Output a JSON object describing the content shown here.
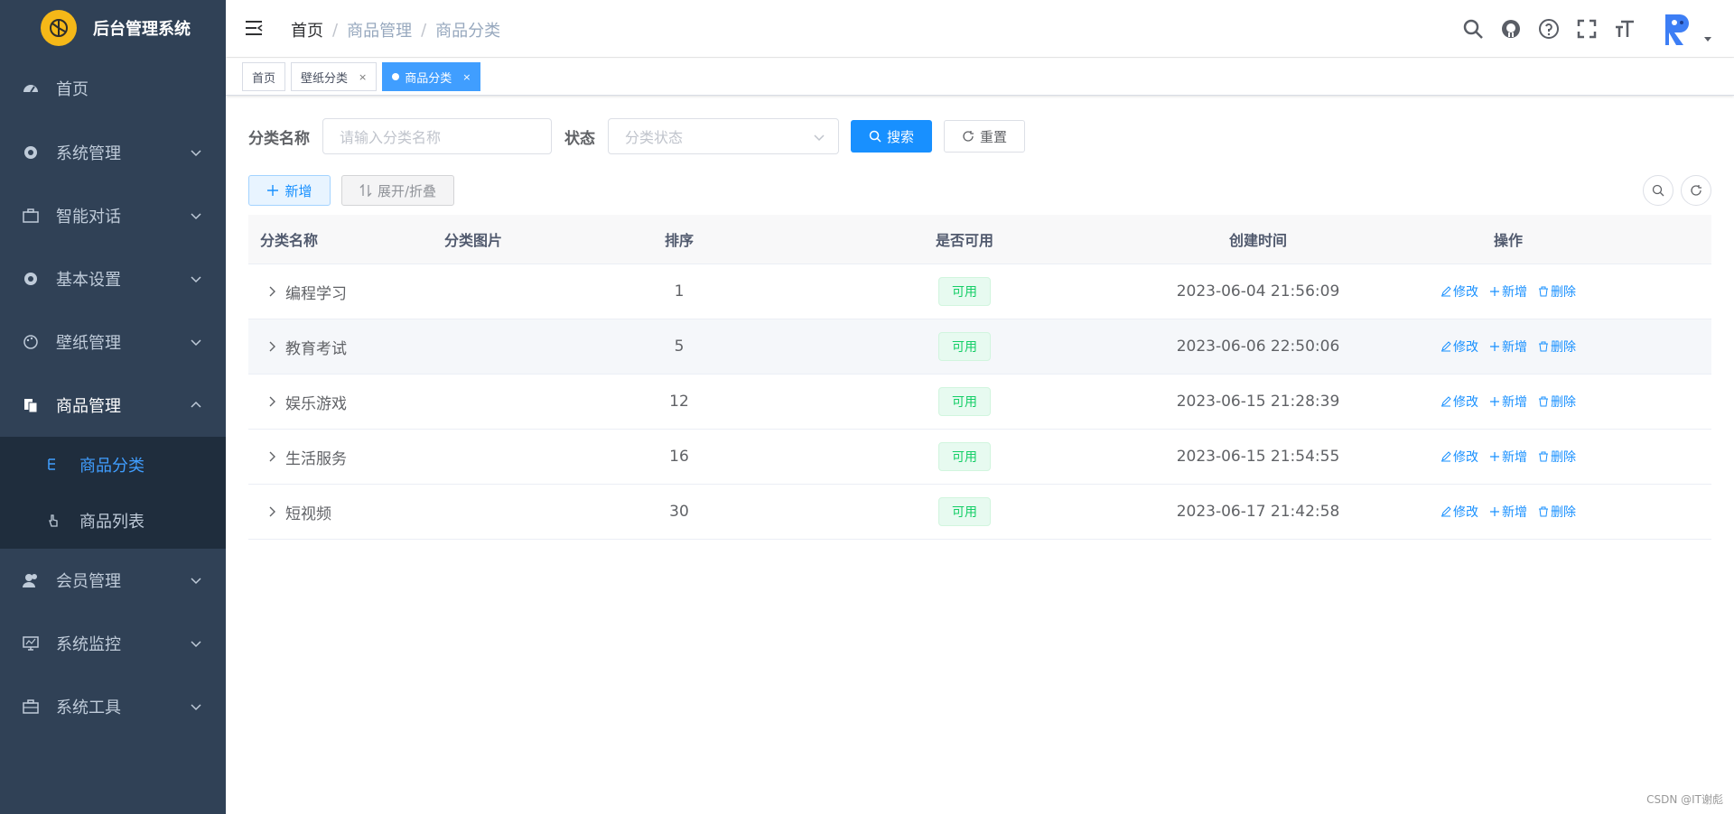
{
  "app": {
    "title": "后台管理系统"
  },
  "sidebar": {
    "items": [
      {
        "label": "首页",
        "icon": "dashboard-icon"
      },
      {
        "label": "系统管理",
        "icon": "gear-icon"
      },
      {
        "label": "智能对话",
        "icon": "briefcase-icon"
      },
      {
        "label": "基本设置",
        "icon": "gear-icon"
      },
      {
        "label": "壁纸管理",
        "icon": "palette-icon"
      },
      {
        "label": "商品管理",
        "icon": "documents-icon"
      },
      {
        "label": "会员管理",
        "icon": "users-icon"
      },
      {
        "label": "系统监控",
        "icon": "monitor-icon"
      },
      {
        "label": "系统工具",
        "icon": "toolbox-icon"
      }
    ],
    "submenu": [
      {
        "label": "商品分类",
        "icon": "tree-icon"
      },
      {
        "label": "商品列表",
        "icon": "hand-icon"
      }
    ]
  },
  "breadcrumb": {
    "home": "首页",
    "level1": "商品管理",
    "level2": "商品分类",
    "sep": "/"
  },
  "tags": {
    "home": "首页",
    "wallpaper": "壁纸分类",
    "current": "商品分类",
    "close": "×"
  },
  "search": {
    "name_label": "分类名称",
    "name_placeholder": "请输入分类名称",
    "status_label": "状态",
    "status_placeholder": "分类状态",
    "search_btn": "搜索",
    "reset_btn": "重置"
  },
  "toolbar": {
    "add_btn": "新增",
    "expand_btn": "展开/折叠"
  },
  "table": {
    "headers": {
      "name": "分类名称",
      "image": "分类图片",
      "sort": "排序",
      "status": "是否可用",
      "time": "创建时间",
      "ops": "操作"
    },
    "rows": [
      {
        "name": "编程学习",
        "sort": "1",
        "status": "可用",
        "time": "2023-06-04 21:56:09"
      },
      {
        "name": "教育考试",
        "sort": "5",
        "status": "可用",
        "time": "2023-06-06 22:50:06"
      },
      {
        "name": "娱乐游戏",
        "sort": "12",
        "status": "可用",
        "time": "2023-06-15 21:28:39"
      },
      {
        "name": "生活服务",
        "sort": "16",
        "status": "可用",
        "time": "2023-06-15 21:54:55"
      },
      {
        "name": "短视频",
        "sort": "30",
        "status": "可用",
        "time": "2023-06-17 21:42:58"
      }
    ],
    "ops": {
      "edit": "修改",
      "add": "新增",
      "delete": "删除"
    }
  },
  "watermark": "CSDN @IT谢彪",
  "colors": {
    "sidebar": "#304156",
    "primary": "#1890ff",
    "success": "#13ce66"
  }
}
